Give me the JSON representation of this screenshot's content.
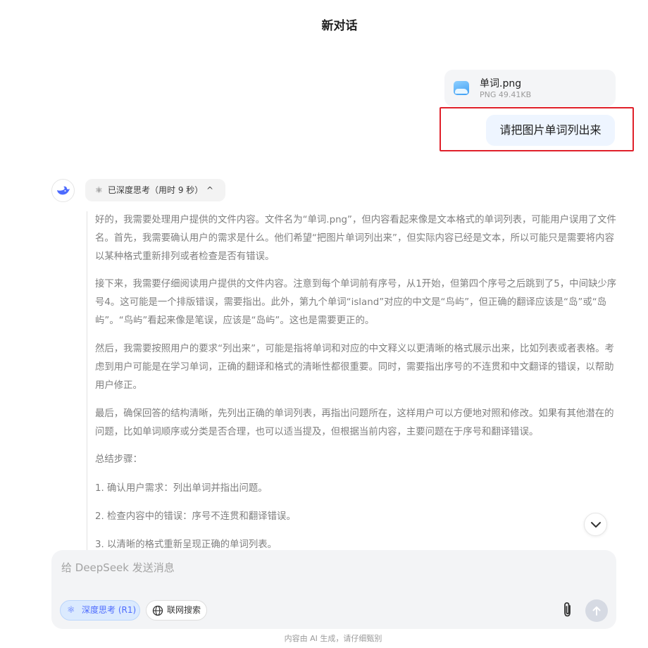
{
  "header": {
    "title": "新对话"
  },
  "attachment": {
    "file_name": "单词.png",
    "file_meta": "PNG 49.41KB",
    "icon": "image-file-icon"
  },
  "user_message": {
    "text": "请把图片单词列出来"
  },
  "assistant": {
    "avatar_icon": "deepseek-whale-icon",
    "thinking_toggle": {
      "icon": "atom-icon",
      "label": "已深度思考（用时 9 秒）",
      "chevron": "^"
    },
    "thought_paragraphs": [
      "好的，我需要处理用户提供的文件内容。文件名为“单词.png”，但内容看起来像是文本格式的单词列表，可能用户误用了文件名。首先，我需要确认用户的需求是什么。他们希望“把图片单词列出来”，但实际内容已经是文本，所以可能只是需要将内容以某种格式重新排列或者检查是否有错误。",
      "接下来，我需要仔细阅读用户提供的文件内容。注意到每个单词前有序号，从1开始，但第四个序号之后跳到了5，中间缺少序号4。这可能是一个排版错误，需要指出。此外，第九个单词“island”对应的中文是“鸟屿”，但正确的翻译应该是“岛”或“岛屿”。“鸟屿”看起来像是笔误，应该是“岛屿”。这也是需要更正的。",
      "然后，我需要按照用户的要求“列出来”，可能是指将单词和对应的中文释义以更清晰的格式展示出来，比如列表或者表格。考虑到用户可能是在学习单词，正确的翻译和格式的清晰性都很重要。同时，需要指出序号的不连贯和中文翻译的错误，以帮助用户修正。",
      "最后，确保回答的结构清晰，先列出正确的单词列表，再指出问题所在，这样用户可以方便地对照和修改。如果有其他潜在的问题，比如单词顺序或分类是否合理，也可以适当提及，但根据当前内容，主要问题在于序号和翻译错误。",
      "总结步骤：",
      "1. 确认用户需求：列出单词并指出问题。",
      "2. 检查内容中的错误：序号不连贯和翻译错误。",
      "3. 以清晰的格式重新呈现正确的单词列表。"
    ]
  },
  "composer": {
    "placeholder": "给 DeepSeek 发送消息",
    "deep_think_label": "深度思考 (R1)",
    "web_search_label": "联网搜索",
    "attach_icon": "paperclip-icon",
    "send_icon": "arrow-up-icon",
    "deep_think_active": true
  },
  "footer": {
    "note": "内容由 AI 生成，请仔细甄别"
  },
  "colors": {
    "accent": "#4d6bfe",
    "highlight_border": "#e0202a",
    "user_bubble": "#eef5ff"
  }
}
